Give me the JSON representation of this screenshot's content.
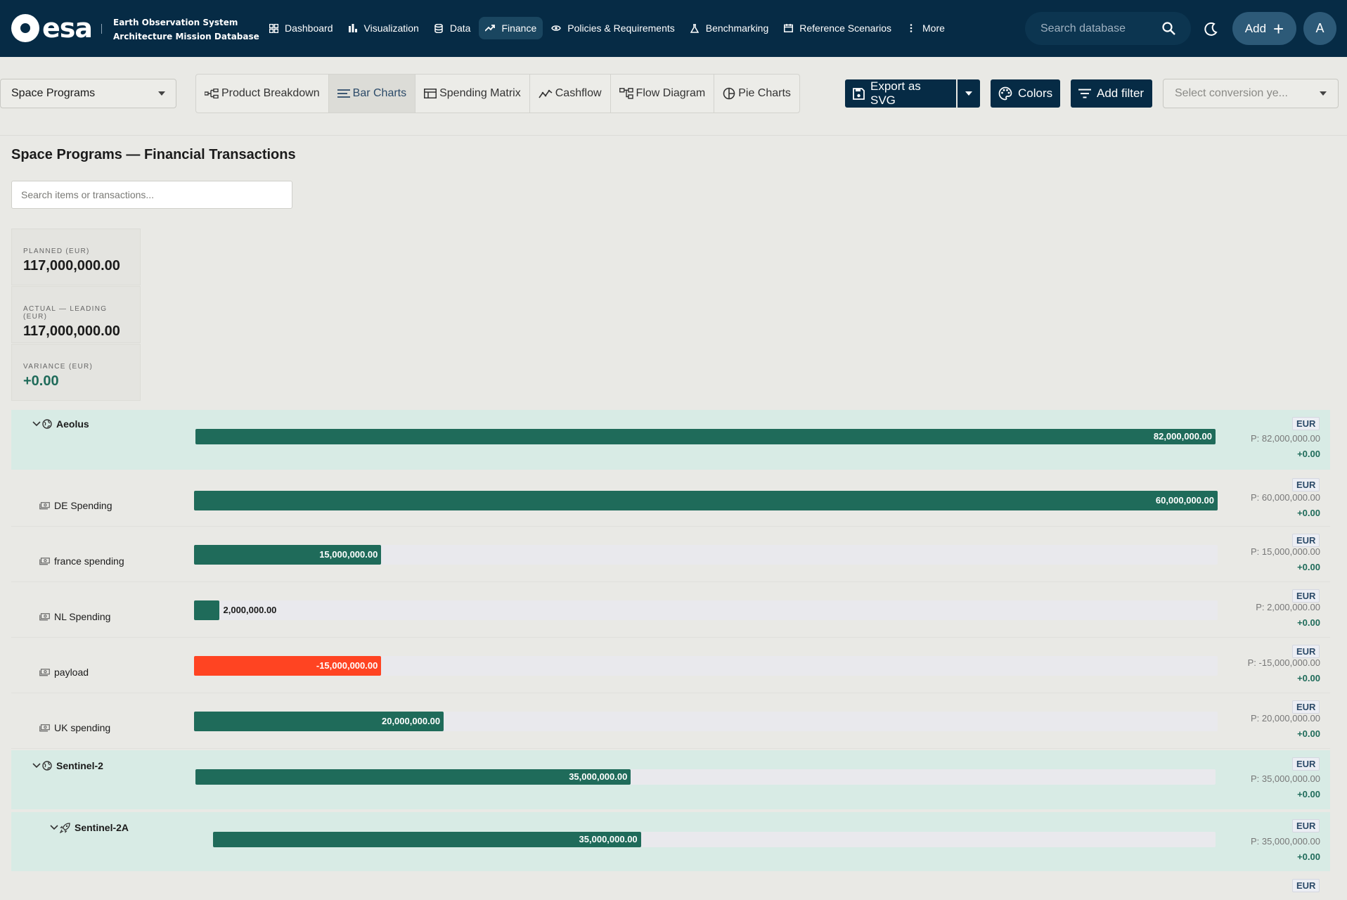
{
  "brand": {
    "logo_text": "esa",
    "subtitle_line1": "Earth Observation System",
    "subtitle_line2": "Architecture Mission Database"
  },
  "nav": {
    "items": [
      {
        "label": "Dashboard",
        "icon": "grid-icon"
      },
      {
        "label": "Visualization",
        "icon": "bar-chart-icon"
      },
      {
        "label": "Data",
        "icon": "database-icon"
      },
      {
        "label": "Finance",
        "icon": "trending-icon",
        "active": true
      },
      {
        "label": "Policies & Requirements",
        "icon": "eye-icon"
      },
      {
        "label": "Benchmarking",
        "icon": "flask-icon"
      },
      {
        "label": "Reference Scenarios",
        "icon": "calendar-icon"
      },
      {
        "label": "More",
        "icon": "dots-vertical-icon"
      }
    ],
    "search_placeholder": "Search database",
    "add_label": "Add",
    "avatar_initial": "A"
  },
  "toolbar": {
    "program_select": "Space Programs",
    "tabs": [
      {
        "label": "Product Breakdown",
        "icon": "tree-icon"
      },
      {
        "label": "Bar Charts",
        "icon": "bars-horizontal-icon",
        "active": true
      },
      {
        "label": "Spending Matrix",
        "icon": "table-icon"
      },
      {
        "label": "Cashflow",
        "icon": "line-chart-icon"
      },
      {
        "label": "Flow Diagram",
        "icon": "flow-icon"
      },
      {
        "label": "Pie Charts",
        "icon": "pie-icon"
      }
    ],
    "export_label": "Export as SVG",
    "colors_label": "Colors",
    "filter_label": "Add filter",
    "conversion_placeholder": "Select conversion ye..."
  },
  "main": {
    "title": "Space Programs — Financial Transactions",
    "search_placeholder": "Search items or transactions...",
    "stats": [
      {
        "label": "PLANNED (EUR)",
        "value": "117,000,000.00"
      },
      {
        "label": "ACTUAL — LEADING (EUR)",
        "value": "117,000,000.00"
      },
      {
        "label": "VARIANCE (EUR)",
        "value": "+0.00"
      }
    ]
  },
  "rows": [
    {
      "name": "Aeolus",
      "type": "group",
      "level": 0,
      "icon": "globe-icon",
      "value": 82000000,
      "value_label": "82,000,000.00",
      "currency": "EUR",
      "planned": "P: 82,000,000.00",
      "variance": "+0.00"
    },
    {
      "name": "DE Spending",
      "type": "item",
      "level": 1,
      "icon": "cash-icon",
      "value": 60000000,
      "value_label": "60,000,000.00",
      "currency": "EUR",
      "planned": "P: 60,000,000.00",
      "variance": "+0.00"
    },
    {
      "name": "france spending",
      "type": "item",
      "level": 1,
      "icon": "cash-icon",
      "value": 15000000,
      "value_label": "15,000,000.00",
      "currency": "EUR",
      "planned": "P: 15,000,000.00",
      "variance": "+0.00"
    },
    {
      "name": "NL Spending",
      "type": "item",
      "level": 1,
      "icon": "cash-icon",
      "value": 2000000,
      "value_label": "2,000,000.00",
      "currency": "EUR",
      "planned": "P: 2,000,000.00",
      "variance": "+0.00"
    },
    {
      "name": "payload",
      "type": "item",
      "level": 1,
      "icon": "cash-icon",
      "value": -15000000,
      "value_label": "-15,000,000.00",
      "currency": "EUR",
      "planned": "P: -15,000,000.00",
      "variance": "+0.00"
    },
    {
      "name": "UK spending",
      "type": "item",
      "level": 1,
      "icon": "cash-icon",
      "value": 20000000,
      "value_label": "20,000,000.00",
      "currency": "EUR",
      "planned": "P: 20,000,000.00",
      "variance": "+0.00"
    },
    {
      "name": "Sentinel-2",
      "type": "group",
      "level": 0,
      "icon": "globe-icon",
      "value": 35000000,
      "value_label": "35,000,000.00",
      "currency": "EUR",
      "planned": "P: 35,000,000.00",
      "variance": "+0.00"
    },
    {
      "name": "Sentinel-2A",
      "type": "group",
      "level": 1,
      "icon": "rocket-icon",
      "value": 35000000,
      "value_label": "35,000,000.00",
      "currency": "EUR",
      "planned": "P: 35,000,000.00",
      "variance": "+0.00"
    }
  ],
  "partial_row": {
    "currency": "EUR"
  },
  "colors": {
    "brand": "#062b45",
    "positive": "#1f6b5a",
    "negative": "#ff4422",
    "group_bg": "#d8ebe5"
  }
}
